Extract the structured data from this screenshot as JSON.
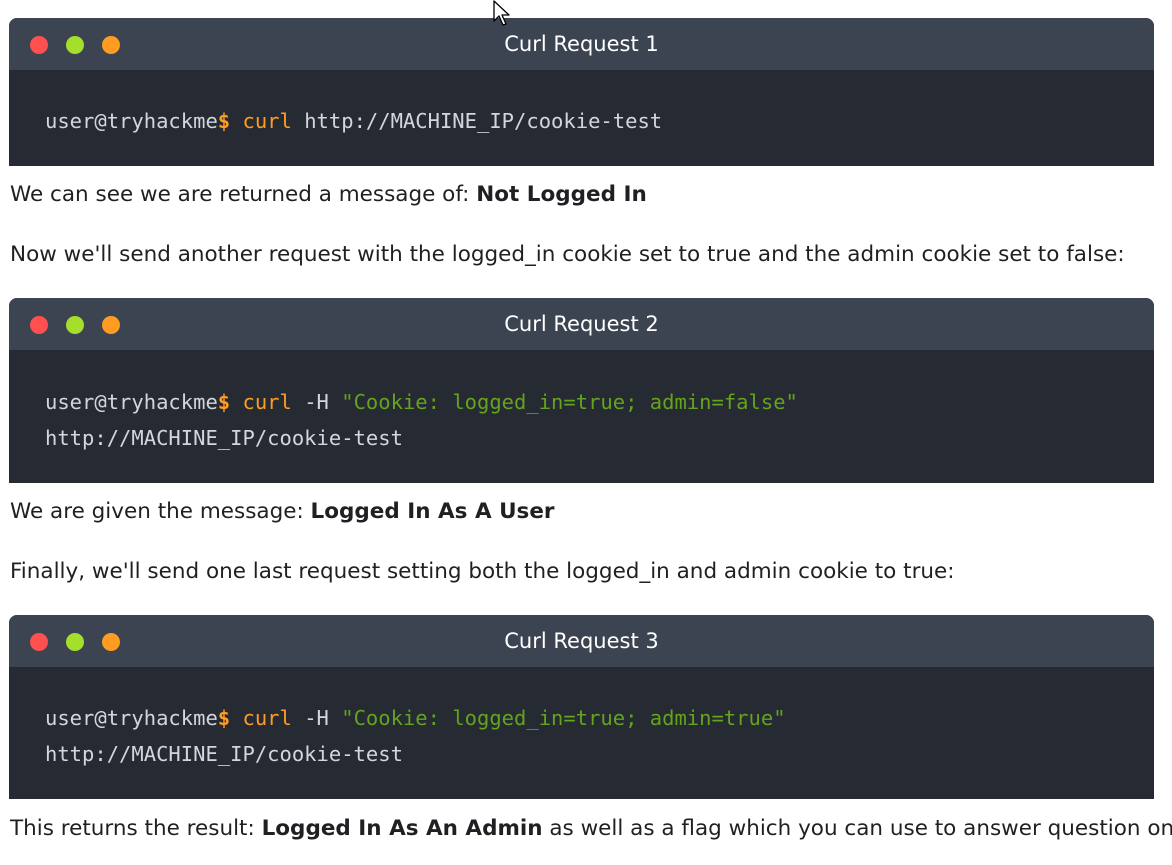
{
  "terminals": [
    {
      "title": "Curl Request 1",
      "lines": [
        {
          "prompt": "user@tryhackme",
          "dollar": "$",
          "cmd": "curl",
          "args": "http://MACHINE_IP/cookie-test",
          "str": ""
        }
      ]
    },
    {
      "title": "Curl Request 2",
      "lines": [
        {
          "prompt": "user@tryhackme",
          "dollar": "$",
          "cmd": "curl",
          "args": "-H",
          "str": "\"Cookie: logged_in=true; admin=false\""
        },
        {
          "plain": "http://MACHINE_IP/cookie-test"
        }
      ]
    },
    {
      "title": "Curl Request 3",
      "lines": [
        {
          "prompt": "user@tryhackme",
          "dollar": "$",
          "cmd": "curl",
          "args": "-H",
          "str": "\"Cookie: logged_in=true; admin=true\""
        },
        {
          "plain": "http://MACHINE_IP/cookie-test"
        }
      ]
    }
  ],
  "paragraphs": {
    "p1": {
      "text": "We can see we are returned a message of: ",
      "bold": "Not Logged In",
      "after": ""
    },
    "p2": {
      "text": "Now we'll send another request with the logged_in cookie set to true and the admin cookie set to false:",
      "bold": "",
      "after": ""
    },
    "p3": {
      "text": "We are given the message: ",
      "bold": "Logged In As A User",
      "after": ""
    },
    "p4": {
      "text": "Finally, we'll send one last request setting both the logged_in and admin cookie to true:",
      "bold": "",
      "after": ""
    },
    "p5": {
      "text": "This returns the result: ",
      "bold": "Logged In As An Admin",
      "after": " as well as a flag which you can use to answer question one."
    }
  },
  "colors": {
    "terminal_bg": "#262a33",
    "terminal_header": "#3d4451",
    "dot_red": "#ff4f4f",
    "dot_green": "#a3df2b",
    "dot_orange": "#ff9c21",
    "command": "#ff9c21",
    "string": "#64a31e"
  },
  "icons": {
    "cursor": "mouse-pointer-icon"
  }
}
